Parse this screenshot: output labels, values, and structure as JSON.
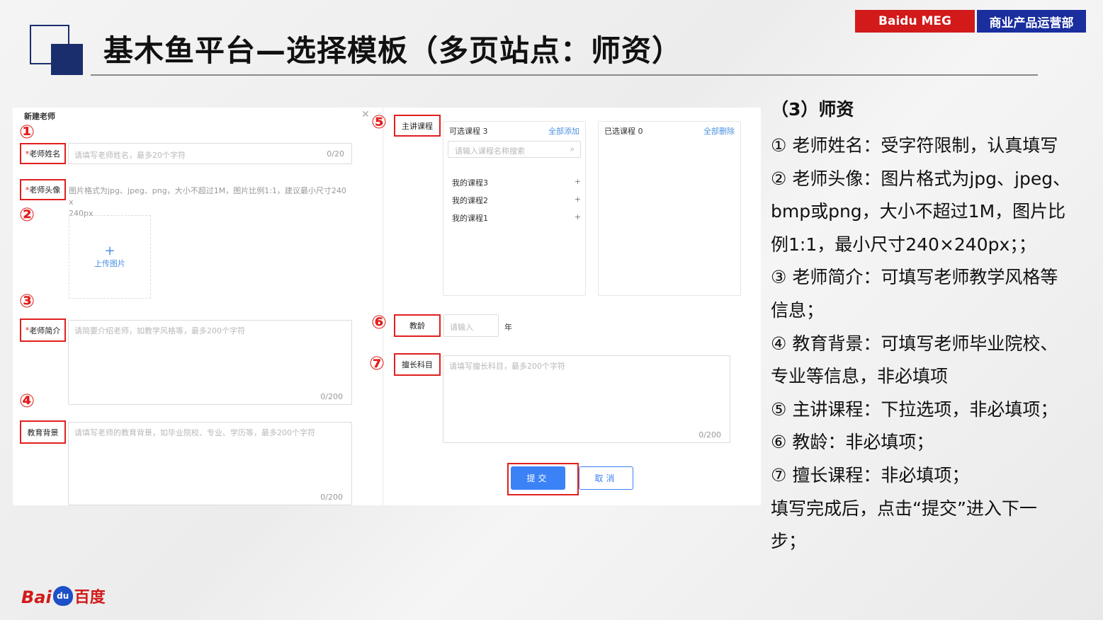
{
  "header": {
    "title": "基木鱼平台—选择模板（多页站点：师资）",
    "tag_red": "Baidu MEG",
    "tag_blue": "商业产品运营部"
  },
  "form": {
    "dialog_title": "新建老师",
    "close_icon": "close-icon",
    "numbers": [
      "①",
      "②",
      "③",
      "④",
      "⑤",
      "⑥",
      "⑦"
    ],
    "name": {
      "required": "*",
      "label": "老师姓名",
      "placeholder": "请填写老师姓名，最多20个字符",
      "count": "0/20"
    },
    "avatar": {
      "required": "*",
      "label": "老师头像",
      "hint_line1": "图片格式为jpg、jpeg、png，大小不超过1M，图片比例1:1，建议最小尺寸240 x",
      "hint_line2": "240px",
      "upload_plus": "+",
      "upload_label": "上传图片"
    },
    "intro": {
      "required": "*",
      "label": "老师简介",
      "placeholder": "请简要介绍老师，如教学风格等，最多200个字符",
      "count": "0/200"
    },
    "education": {
      "label": "教育背景",
      "placeholder": "请填写老师的教育背景，如毕业院校、专业、学历等，最多200个字符",
      "count": "0/200"
    },
    "courses": {
      "label": "主讲课程",
      "available_title": "可选课程 3",
      "add_all": "全部添加",
      "search_placeholder": "请输入课程名称搜索",
      "items": [
        {
          "name": "我的课程3",
          "add": "+"
        },
        {
          "name": "我的课程2",
          "add": "+"
        },
        {
          "name": "我的课程1",
          "add": "+"
        }
      ],
      "selected_title": "已选课程 0",
      "remove_all": "全部删除"
    },
    "teaching_years": {
      "label": "教龄",
      "placeholder": "请输入",
      "unit": "年"
    },
    "subjects": {
      "label": "擅长科目",
      "placeholder": "请填写擅长科目，最多200个字符",
      "count": "0/200"
    },
    "submit_label": "提交",
    "cancel_label": "取消"
  },
  "notes": {
    "heading": "（3）师资",
    "lines": [
      "① 老师姓名：受字符限制，认真填写",
      "② 老师头像：图片格式为jpg、jpeg、",
      "bmp或png，大小不超过1M，图片比",
      "例1:1，最小尺寸240×240px；；",
      "③ 老师简介：可填写老师教学风格等",
      "信息；",
      "④ 教育背景：可填写老师毕业院校、",
      "专业等信息，非必填项",
      "⑤ 主讲课程：下拉选项，非必填项；",
      "⑥ 教龄：非必填项；",
      "⑦ 擅长课程：非必填项；",
      "填写完成后，点击“提交”进入下一",
      "步；"
    ]
  },
  "footer": {
    "logo_bai": "Bai",
    "logo_du": "du",
    "logo_cn": "百度"
  },
  "colors": {
    "brand_red": "#d21a1a",
    "brand_blue": "#1a2e9e",
    "annotation_red": "#e0201f",
    "button_blue": "#3b82f6"
  }
}
